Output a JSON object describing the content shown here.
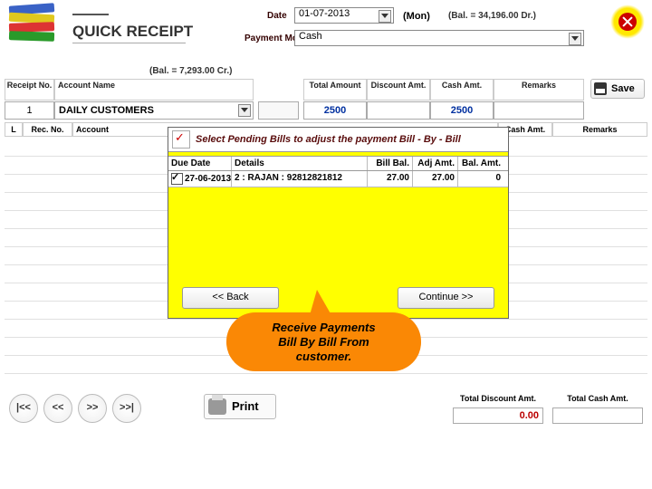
{
  "title": "QUICK RECEIPT",
  "header": {
    "date_label": "Date",
    "date_value": "01-07-2013",
    "day": "(Mon)",
    "balance_top": "(Bal. =  34,196.00 Dr.)",
    "mode_label": "Payment Mode",
    "mode_value": "Cash"
  },
  "balance_row": "(Bal. =  7,293.00 Cr.)",
  "cols": {
    "receipt_no": "Receipt No.",
    "account_name": "Account Name",
    "total_amount": "Total Amount",
    "discount_amt": "Discount Amt.",
    "cash_amt": "Cash Amt.",
    "remarks": "Remarks"
  },
  "row": {
    "receipt_no": "1",
    "account_name": "DAILY CUSTOMERS",
    "total_amount": "2500",
    "discount_amt": "",
    "cash_amt": "2500",
    "remarks": ""
  },
  "save_label": "Save",
  "detail_cols": {
    "l": "L",
    "rec_no": "Rec. No.",
    "account": "Account",
    "cash_amt": "Cash Amt.",
    "remarks": "Remarks"
  },
  "popup": {
    "title": "Select Pending Bills to adjust the payment Bill - By - Bill",
    "cols": {
      "due_date": "Due Date",
      "details": "Details",
      "bill_bal": "Bill Bal.",
      "adj_amt": "Adj Amt.",
      "bal_amt": "Bal. Amt."
    },
    "row": {
      "checked": true,
      "due_date": "27-06-2013",
      "details": "2 : RAJAN : 92812821812",
      "bill_bal": "27.00",
      "adj_amt": "27.00",
      "bal_amt": "0"
    },
    "back": "<< Back",
    "continue": "Continue >>"
  },
  "callout": "Receive Payments\nBill By Bill From\ncustomer.",
  "nav": {
    "first": "|<<",
    "prev": "<<",
    "next": ">>",
    "last": ">>|"
  },
  "print_label": "Print",
  "totals": {
    "disc_label": "Total Discount Amt.",
    "disc_value": "0.00",
    "cash_label": "Total Cash Amt.",
    "cash_value": ""
  }
}
